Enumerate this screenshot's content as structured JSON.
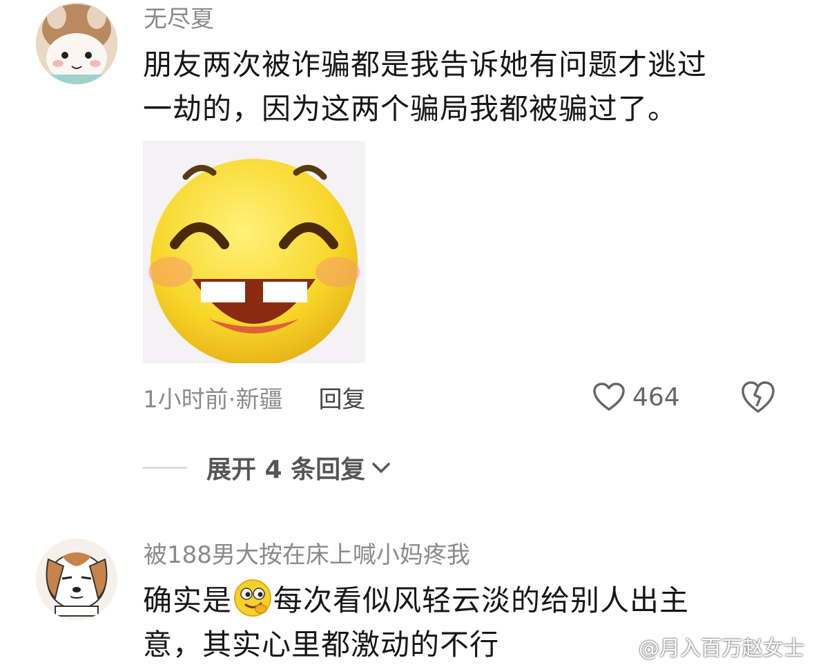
{
  "comments": [
    {
      "username": "无尽夏",
      "text_lines": [
        "朋友两次被诈骗都是我告诉她有问题才逃过",
        "一劫的，因为这两个骗局我都被骗过了。"
      ],
      "meta": "1小时前·新疆",
      "reply_label": "回复",
      "likes": "464",
      "expand_label": "展开 4 条回复"
    },
    {
      "username": "被188男大按在床上喊小妈疼我",
      "text_line1_before": "确实是",
      "text_line1_after": "每次看似风轻云淡的给别人出主",
      "text_line2": "意，其实心里都激动的不行"
    }
  ],
  "watermark": "@月入百万赵女士",
  "icons": {
    "like": "heart-outline-icon",
    "dislike": "broken-heart-icon",
    "expand": "chevron-down-icon",
    "weibo": "weibo-logo-icon"
  },
  "colors": {
    "sticker_yellow": "#f7d628",
    "meta_gray": "#8c8c8c"
  }
}
